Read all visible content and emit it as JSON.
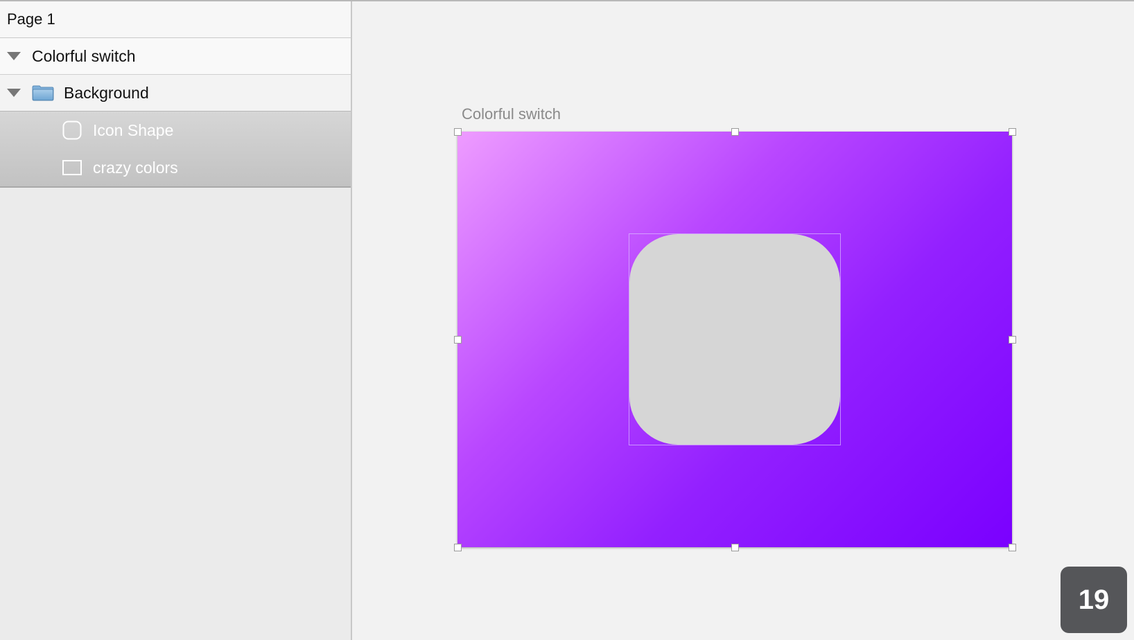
{
  "layers_panel": {
    "page_name": "Page 1",
    "artboard_name": "Colorful switch",
    "group_name": "Background",
    "layers": [
      {
        "label": "Icon Shape",
        "icon": "rounded-rect-icon"
      },
      {
        "label": "crazy colors",
        "icon": "rectangle-icon"
      }
    ]
  },
  "canvas": {
    "artboard_label": "Colorful switch",
    "gradient_colors": [
      "#ee9cff",
      "#b947ff",
      "#9320ff",
      "#7a00ff"
    ],
    "icon_shape_color": "#d6d6d6"
  },
  "badge": {
    "value": "19"
  }
}
